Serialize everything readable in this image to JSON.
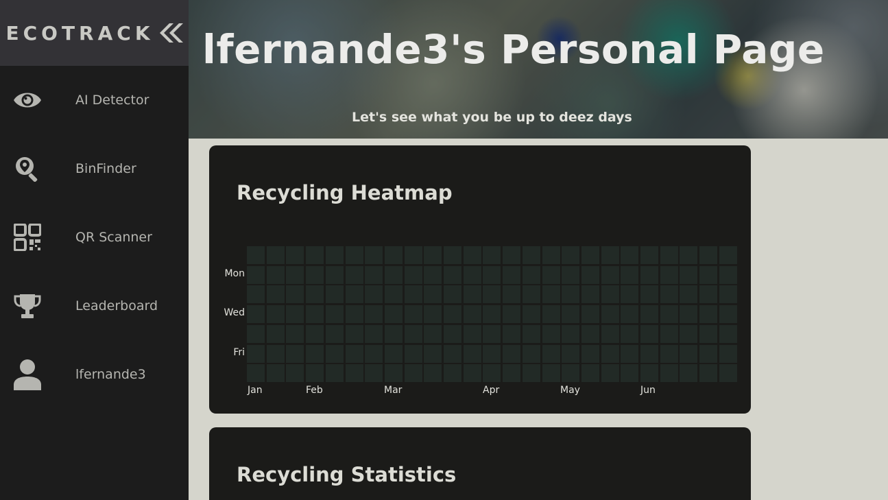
{
  "sidebar": {
    "logo_text": "ECOTRACK",
    "logo_icon": "double-chevron-left-icon",
    "items": [
      {
        "label": "AI Detector",
        "icon": "eye-icon"
      },
      {
        "label": "BinFinder",
        "icon": "map-search-icon"
      },
      {
        "label": "QR Scanner",
        "icon": "qr-code-icon"
      },
      {
        "label": "Leaderboard",
        "icon": "trophy-icon"
      },
      {
        "label": "lfernande3",
        "icon": "user-icon"
      }
    ]
  },
  "header": {
    "title": "lfernande3's Personal Page",
    "subtitle": "Let's see what you be up to deez days"
  },
  "heatmap_card": {
    "title": "Recycling Heatmap",
    "day_labels": [
      "Mon",
      "Wed",
      "Fri"
    ],
    "month_labels": [
      "Jan",
      "Feb",
      "Mar",
      "Apr",
      "May",
      "Jun"
    ],
    "weeks": 25,
    "days": 7,
    "cell_color": "#222a26"
  },
  "stats_card": {
    "title": "Recycling Statistics"
  },
  "colors": {
    "sidebar_bg": "#1c1c1c",
    "logo_bg": "#333236",
    "page_bg": "#d5d5cc",
    "card_bg": "#1b1b19"
  }
}
